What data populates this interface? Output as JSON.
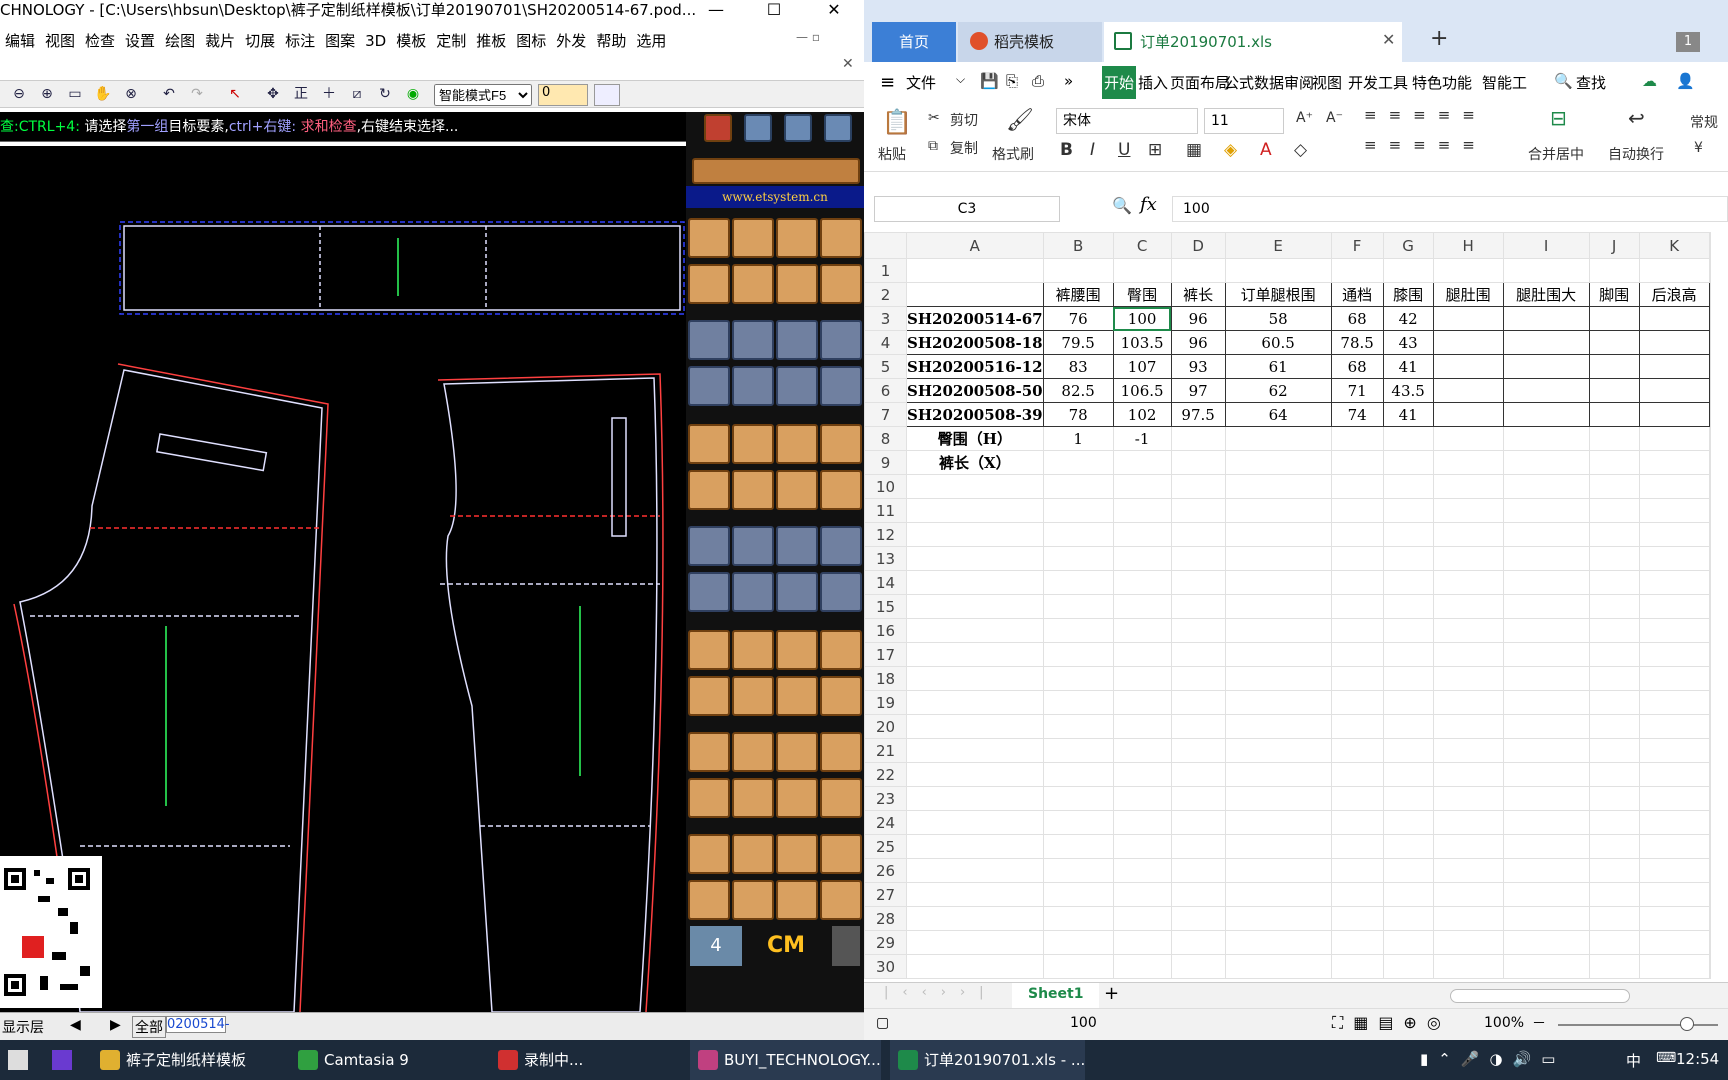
{
  "left_app": {
    "title": "CHNOLOGY - [C:\\Users\\hbsun\\Desktop\\裤子定制纸样模板\\订单20190701\\SH20200514-67.pod...",
    "window_buttons": [
      "—",
      "☐",
      "✕"
    ],
    "menu": [
      "编辑",
      "视图",
      "检查",
      "设置",
      "绘图",
      "裁片",
      "切展",
      "标注",
      "图案",
      "3D",
      "模板",
      "定制",
      "推板",
      "图标",
      "外发",
      "帮助",
      "选用"
    ],
    "mode_select": "智能模式F5",
    "number_field": "0",
    "hint": {
      "p1": "查:CTRL+4:",
      "p2": " 请选择",
      "p3": "第一组",
      "p4": "目标要素,",
      "p5": "ctrl+右键:",
      "p6": " 求和检查",
      "p7": ",右键结束选择..."
    },
    "site": "www.etsystem.cn",
    "unit": "CM",
    "status": {
      "layer": "显示层",
      "all": "全部",
      "field": "0200514-"
    }
  },
  "excel": {
    "tabs": [
      {
        "label": "首页"
      },
      {
        "label": "稻壳模板"
      },
      {
        "label": "订单20190701.xls"
      }
    ],
    "tab_badge": "1",
    "menu": [
      "文件",
      "开始",
      "插入",
      "页面布局",
      "公式",
      "数据",
      "审阅",
      "视图",
      "开发工具",
      "特色功能",
      "智能工",
      "查找"
    ],
    "ribbon": {
      "paste": "粘贴",
      "cut": "剪切",
      "copy": "复制",
      "format_painter": "格式刷",
      "font": "宋体",
      "size": "11",
      "merge": "合并居中",
      "wrap": "自动换行",
      "number_format": "常规"
    },
    "namebox": "C3",
    "fx": "fx",
    "formula": "100",
    "columns": [
      "A",
      "B",
      "C",
      "D",
      "E",
      "F",
      "G",
      "H",
      "I",
      "J",
      "K"
    ],
    "rows": [
      {
        "n": "1",
        "c": [
          "",
          "",
          "",
          "",
          "",
          "",
          "",
          "",
          "",
          "",
          ""
        ]
      },
      {
        "n": "2",
        "c": [
          "",
          "裤腰围",
          "臀围",
          "裤长",
          "订单腿根围",
          "通档",
          "膝围",
          "腿肚围",
          "腿肚围大",
          "脚围",
          "后浪高"
        ]
      },
      {
        "n": "3",
        "c": [
          "SH20200514-67",
          "76",
          "100",
          "96",
          "58",
          "68",
          "42",
          "",
          "",
          "",
          ""
        ]
      },
      {
        "n": "4",
        "c": [
          "SH20200508-18",
          "79.5",
          "103.5",
          "96",
          "60.5",
          "78.5",
          "43",
          "",
          "",
          "",
          ""
        ]
      },
      {
        "n": "5",
        "c": [
          "SH20200516-12",
          "83",
          "107",
          "93",
          "61",
          "68",
          "41",
          "",
          "",
          "",
          ""
        ]
      },
      {
        "n": "6",
        "c": [
          "SH20200508-50",
          "82.5",
          "106.5",
          "97",
          "62",
          "71",
          "43.5",
          "",
          "",
          "",
          ""
        ]
      },
      {
        "n": "7",
        "c": [
          "SH20200508-39",
          "78",
          "102",
          "97.5",
          "64",
          "74",
          "41",
          "",
          "",
          "",
          ""
        ]
      },
      {
        "n": "8",
        "c": [
          "臀围（H）",
          "1",
          "-1",
          "",
          "",
          "",
          "",
          "",
          "",
          "",
          ""
        ]
      },
      {
        "n": "9",
        "c": [
          "裤长（X）",
          "",
          "",
          "",
          "",
          "",
          "",
          "",
          "",
          "",
          ""
        ]
      },
      {
        "n": "10",
        "c": []
      },
      {
        "n": "11",
        "c": []
      },
      {
        "n": "12",
        "c": []
      },
      {
        "n": "13",
        "c": []
      },
      {
        "n": "14",
        "c": []
      },
      {
        "n": "15",
        "c": []
      },
      {
        "n": "16",
        "c": []
      },
      {
        "n": "17",
        "c": []
      },
      {
        "n": "18",
        "c": []
      },
      {
        "n": "19",
        "c": []
      },
      {
        "n": "20",
        "c": []
      },
      {
        "n": "21",
        "c": []
      },
      {
        "n": "22",
        "c": []
      },
      {
        "n": "23",
        "c": []
      },
      {
        "n": "24",
        "c": []
      },
      {
        "n": "25",
        "c": []
      },
      {
        "n": "26",
        "c": []
      },
      {
        "n": "27",
        "c": []
      },
      {
        "n": "28",
        "c": []
      },
      {
        "n": "29",
        "c": []
      },
      {
        "n": "30",
        "c": []
      }
    ],
    "sheet": "Sheet1",
    "status_value": "100",
    "zoom": "100%"
  },
  "taskbar": {
    "items": [
      "裤子定制纸样模板",
      "Camtasia 9",
      "录制中...",
      "BUYI_TECHNOLOGY...",
      "订单20190701.xls - ..."
    ],
    "ime": "中",
    "time": "12:54"
  },
  "colors": {
    "accent": "#1e8a4a",
    "tab_blue": "#3c7fd6",
    "cad_bg": "#000000"
  }
}
